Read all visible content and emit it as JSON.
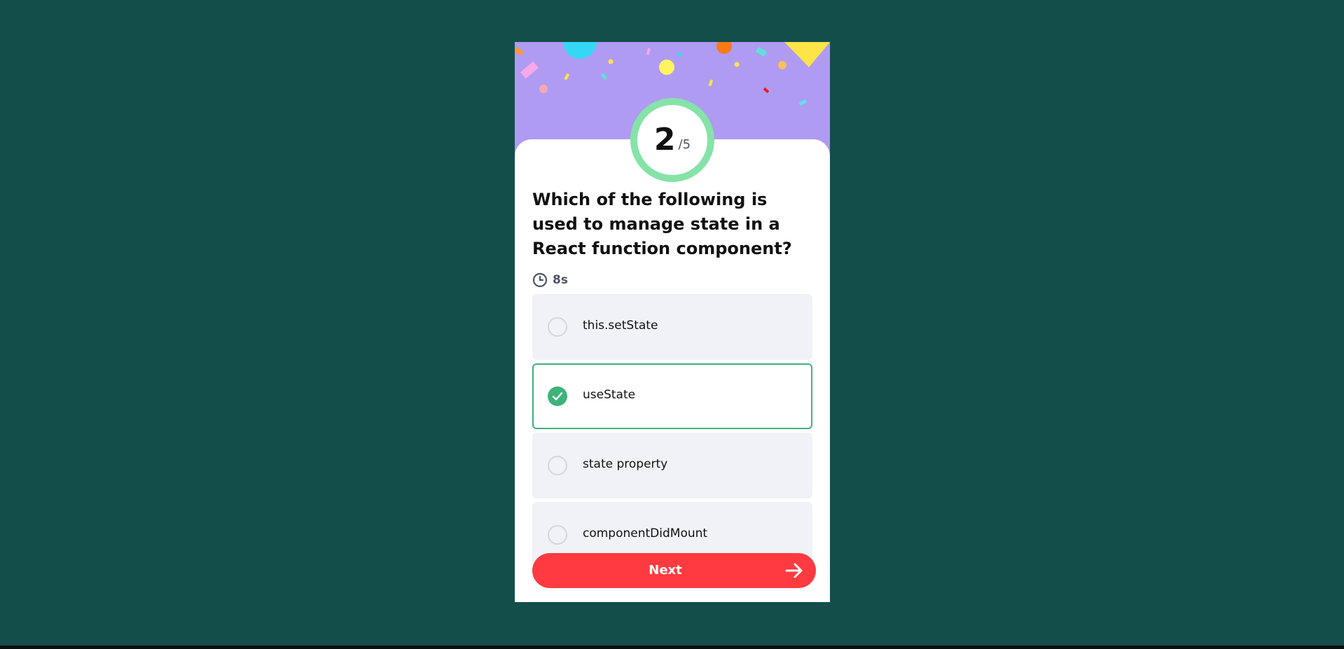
{
  "colors": {
    "page_background": "#134e4a",
    "hero_background": "#af9bf2",
    "progress_ring": "#86e3a8",
    "selected_accent": "#3fb27a",
    "option_background": "#f1f2f8",
    "next_button": "#ff3a41"
  },
  "counter": {
    "current": "2",
    "total": "/5"
  },
  "question": {
    "text": "Which of the following is used to manage state in a React function component?"
  },
  "timer": {
    "icon": "clock-icon",
    "value": "8s"
  },
  "options": [
    {
      "label": "this.setState",
      "selected": false
    },
    {
      "label": "useState",
      "selected": true
    },
    {
      "label": "state property",
      "selected": false
    },
    {
      "label": "componentDidMount",
      "selected": false
    }
  ],
  "next_button": {
    "label": "Next",
    "icon": "arrow-right-icon"
  }
}
